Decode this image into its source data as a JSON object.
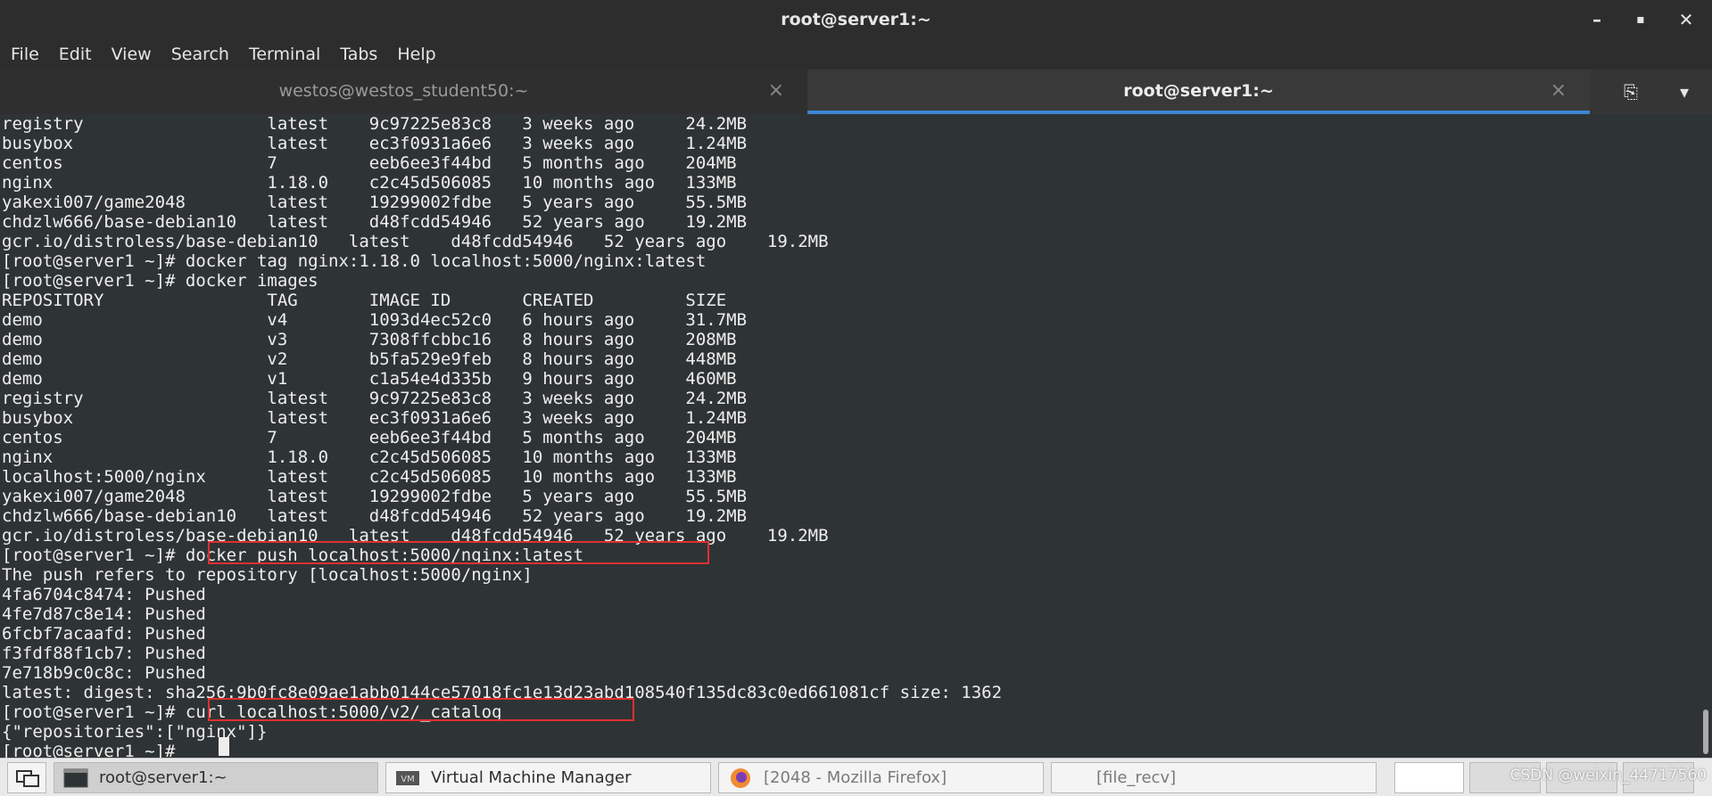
{
  "window": {
    "title": "root@server1:~",
    "minimize": "–",
    "maximize": "▪",
    "close": "✕"
  },
  "menu": [
    "File",
    "Edit",
    "View",
    "Search",
    "Terminal",
    "Tabs",
    "Help"
  ],
  "tabs": [
    {
      "label": "westos@westos_student50:~",
      "close": "×"
    },
    {
      "label": "root@server1:~",
      "close": "×"
    }
  ],
  "tab_actions": {
    "new_tab": "⎘",
    "dropdown": "▾"
  },
  "terminal": {
    "lines": [
      "registry                  latest    9c97225e83c8   3 weeks ago     24.2MB",
      "busybox                   latest    ec3f0931a6e6   3 weeks ago     1.24MB",
      "centos                    7         eeb6ee3f44bd   5 months ago    204MB",
      "nginx                     1.18.0    c2c45d506085   10 months ago   133MB",
      "yakexi007/game2048        latest    19299002fdbe   5 years ago     55.5MB",
      "chdzlw666/base-debian10   latest    d48fcdd54946   52 years ago    19.2MB",
      "gcr.io/distroless/base-debian10   latest    d48fcdd54946   52 years ago    19.2MB",
      "[root@server1 ~]# docker tag nginx:1.18.0 localhost:5000/nginx:latest",
      "[root@server1 ~]# docker images",
      "REPOSITORY                TAG       IMAGE ID       CREATED         SIZE",
      "demo                      v4        1093d4ec52c0   6 hours ago     31.7MB",
      "demo                      v3        7308ffcbbc16   8 hours ago     208MB",
      "demo                      v2        b5fa529e9feb   8 hours ago     448MB",
      "demo                      v1        c1a54e4d335b   9 hours ago     460MB",
      "registry                  latest    9c97225e83c8   3 weeks ago     24.2MB",
      "busybox                   latest    ec3f0931a6e6   3 weeks ago     1.24MB",
      "centos                    7         eeb6ee3f44bd   5 months ago    204MB",
      "nginx                     1.18.0    c2c45d506085   10 months ago   133MB",
      "localhost:5000/nginx      latest    c2c45d506085   10 months ago   133MB",
      "yakexi007/game2048        latest    19299002fdbe   5 years ago     55.5MB",
      "chdzlw666/base-debian10   latest    d48fcdd54946   52 years ago    19.2MB",
      "gcr.io/distroless/base-debian10   latest    d48fcdd54946   52 years ago    19.2MB",
      "[root@server1 ~]# docker push localhost:5000/nginx:latest",
      "The push refers to repository [localhost:5000/nginx]",
      "4fa6704c8474: Pushed",
      "4fe7d87c8e14: Pushed",
      "6fcbf7acaafd: Pushed",
      "f3fdf88f1cb7: Pushed",
      "7e718b9c0c8c: Pushed",
      "latest: digest: sha256:9b0fc8e09ae1abb0144ce57018fc1e13d23abd108540f135dc83c0ed661081cf size: 1362",
      "[root@server1 ~]# curl localhost:5000/v2/_catalog",
      "{\"repositories\":[\"nginx\"]}",
      "[root@server1 ~]# "
    ]
  },
  "taskbar": {
    "items": [
      {
        "label": "root@server1:~"
      },
      {
        "label": "Virtual Machine Manager"
      },
      {
        "label": "[2048 - Mozilla Firefox]"
      },
      {
        "label": "[file_recv]"
      }
    ],
    "watermark": "CSDN @weixin_44717560"
  },
  "colors": {
    "terminal_bg": "#2e3436",
    "highlight": "#e03030",
    "tab_active_accent": "#3d86d4"
  }
}
